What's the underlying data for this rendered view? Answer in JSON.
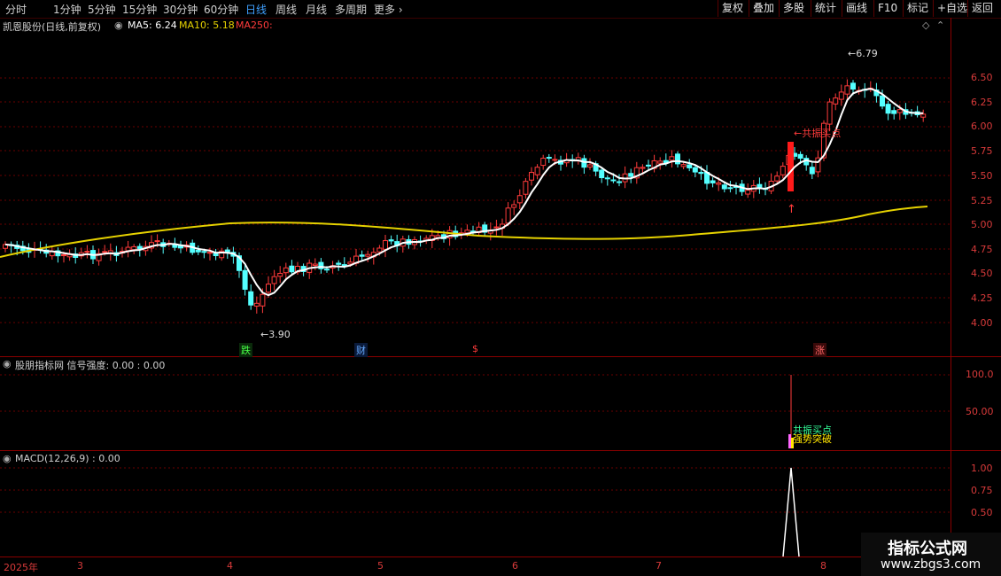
{
  "toolbar": {
    "periods": [
      "分时",
      "1分钟",
      "5分钟",
      "15分钟",
      "30分钟",
      "60分钟",
      "日线",
      "周线",
      "月线",
      "多周期",
      "更多"
    ],
    "active_period": "日线",
    "more_icon": "chevron-right-icon",
    "right_buttons": [
      "复权",
      "叠加",
      "多股",
      "统计",
      "画线",
      "F10",
      "标记",
      "+自选",
      "返回"
    ]
  },
  "main_panel": {
    "stock_title": "凯恩股份(日线,前复权)",
    "ma5_label": "MA5: 6.24",
    "ma10_label": "MA10: 5.18",
    "ma250_label": "MA250:",
    "high_label": "6.79",
    "low_label": "3.90",
    "signal_label": "共振买点",
    "markers": [
      "跌",
      "财",
      "$",
      "涨"
    ],
    "y_ticks": [
      "6.50",
      "6.25",
      "6.00",
      "5.75",
      "5.50",
      "5.25",
      "5.00",
      "4.75",
      "4.50",
      "4.25",
      "4.00"
    ],
    "colors": {
      "up": "#ff3b3b",
      "down": "#54ffff",
      "ma5": "#ffffff",
      "ma250": "#e6d200"
    }
  },
  "indicator_panel": {
    "title": "股朋指标网 信号强度: 0.00 : 0.00",
    "y_ticks": [
      "100.0",
      "50.00"
    ],
    "label_buy": "共振买点",
    "label_break": "强势突破"
  },
  "macd_panel": {
    "title": "MACD(12,26,9) : 0.00",
    "y_ticks": [
      "1.00",
      "0.75",
      "0.50"
    ]
  },
  "date_axis": {
    "year_label": "2025年",
    "months": [
      "3",
      "4",
      "5",
      "6",
      "7",
      "8"
    ]
  },
  "watermark": {
    "line1": "指标公式网",
    "line2": "www.zbgs3.com"
  }
}
